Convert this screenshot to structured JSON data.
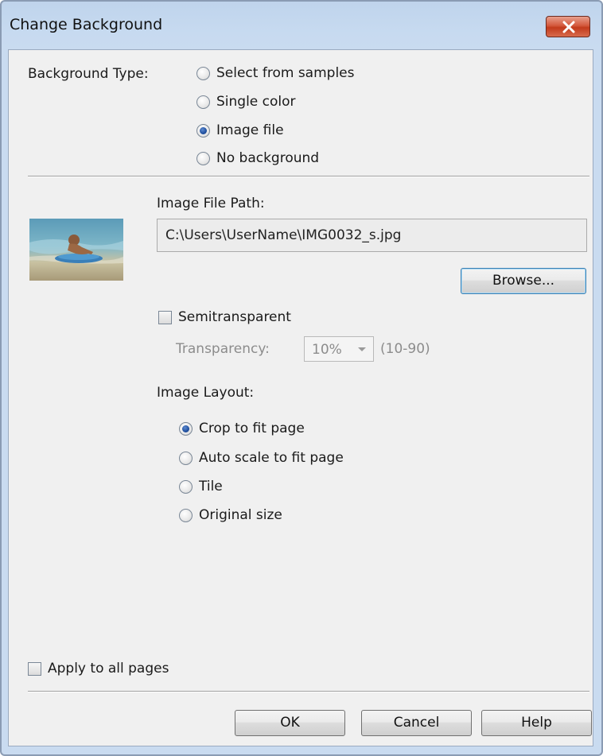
{
  "window": {
    "title": "Change Background",
    "close_label": "Close"
  },
  "background_type": {
    "label": "Background Type:",
    "options": [
      "Select from samples",
      "Single color",
      "Image file",
      "No background"
    ],
    "selected": "Image file"
  },
  "image_file": {
    "path_label": "Image File Path:",
    "path_value": "C:\\Users\\UserName\\IMG0032_s.jpg",
    "browse_label": "Browse..."
  },
  "semitransparent": {
    "label": "Semitransparent",
    "checked": false,
    "transparency_label": "Transparency:",
    "transparency_value": "10%",
    "range_hint": "(10-90)"
  },
  "image_layout": {
    "label": "Image Layout:",
    "options": [
      "Crop to fit page",
      "Auto scale to fit page",
      "Tile",
      "Original size"
    ],
    "selected": "Crop to fit page"
  },
  "apply_all": {
    "label": "Apply to all pages",
    "checked": false
  },
  "footer": {
    "ok_label": "OK",
    "cancel_label": "Cancel",
    "help_label": "Help"
  },
  "colors": {
    "title_gradient": "#c7daf0",
    "close_red": "#c23b1c",
    "client_bg": "#f0f0f0",
    "radio_dot": "#1f4f9e"
  }
}
